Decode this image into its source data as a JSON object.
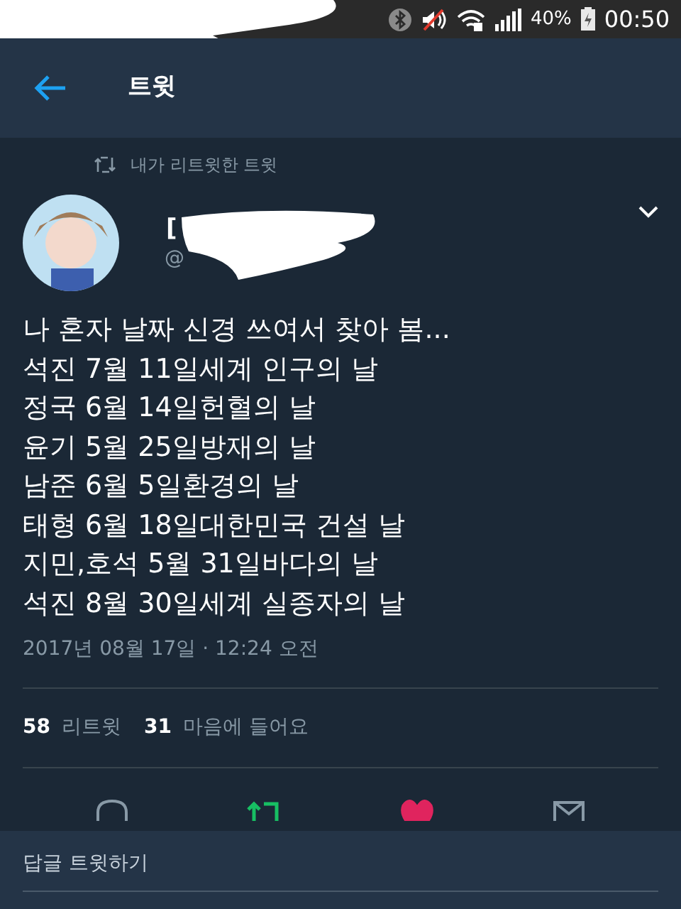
{
  "status_bar": {
    "battery": "40%",
    "time": "00:50"
  },
  "header": {
    "title": "트윗"
  },
  "retweet_note": "내가 리트윗한 트윗",
  "author": {
    "name": "[",
    "handle": "@"
  },
  "tweet_lines": [
    "나 혼자 날짜 신경 쓰여서 찾아 봄...",
    "석진 7월 11일세계 인구의 날",
    "정국 6월 14일헌혈의 날",
    "윤기 5월 25일방재의 날",
    "남준 6월 5일환경의 날",
    "태형 6월 18일대한민국 건설 날",
    "지민,호석 5월 31일바다의 날",
    "석진 8월 30일세계 실종자의 날"
  ],
  "timestamp": "2017년 08월 17일 · 12:24 오전",
  "stats": [
    {
      "count": "58",
      "label": "리트윗"
    },
    {
      "count": "31",
      "label": "마음에 들어요"
    }
  ],
  "actions": {
    "retweeted": true,
    "liked": true
  },
  "reply_bar": {
    "placeholder": "답글 트윗하기"
  }
}
